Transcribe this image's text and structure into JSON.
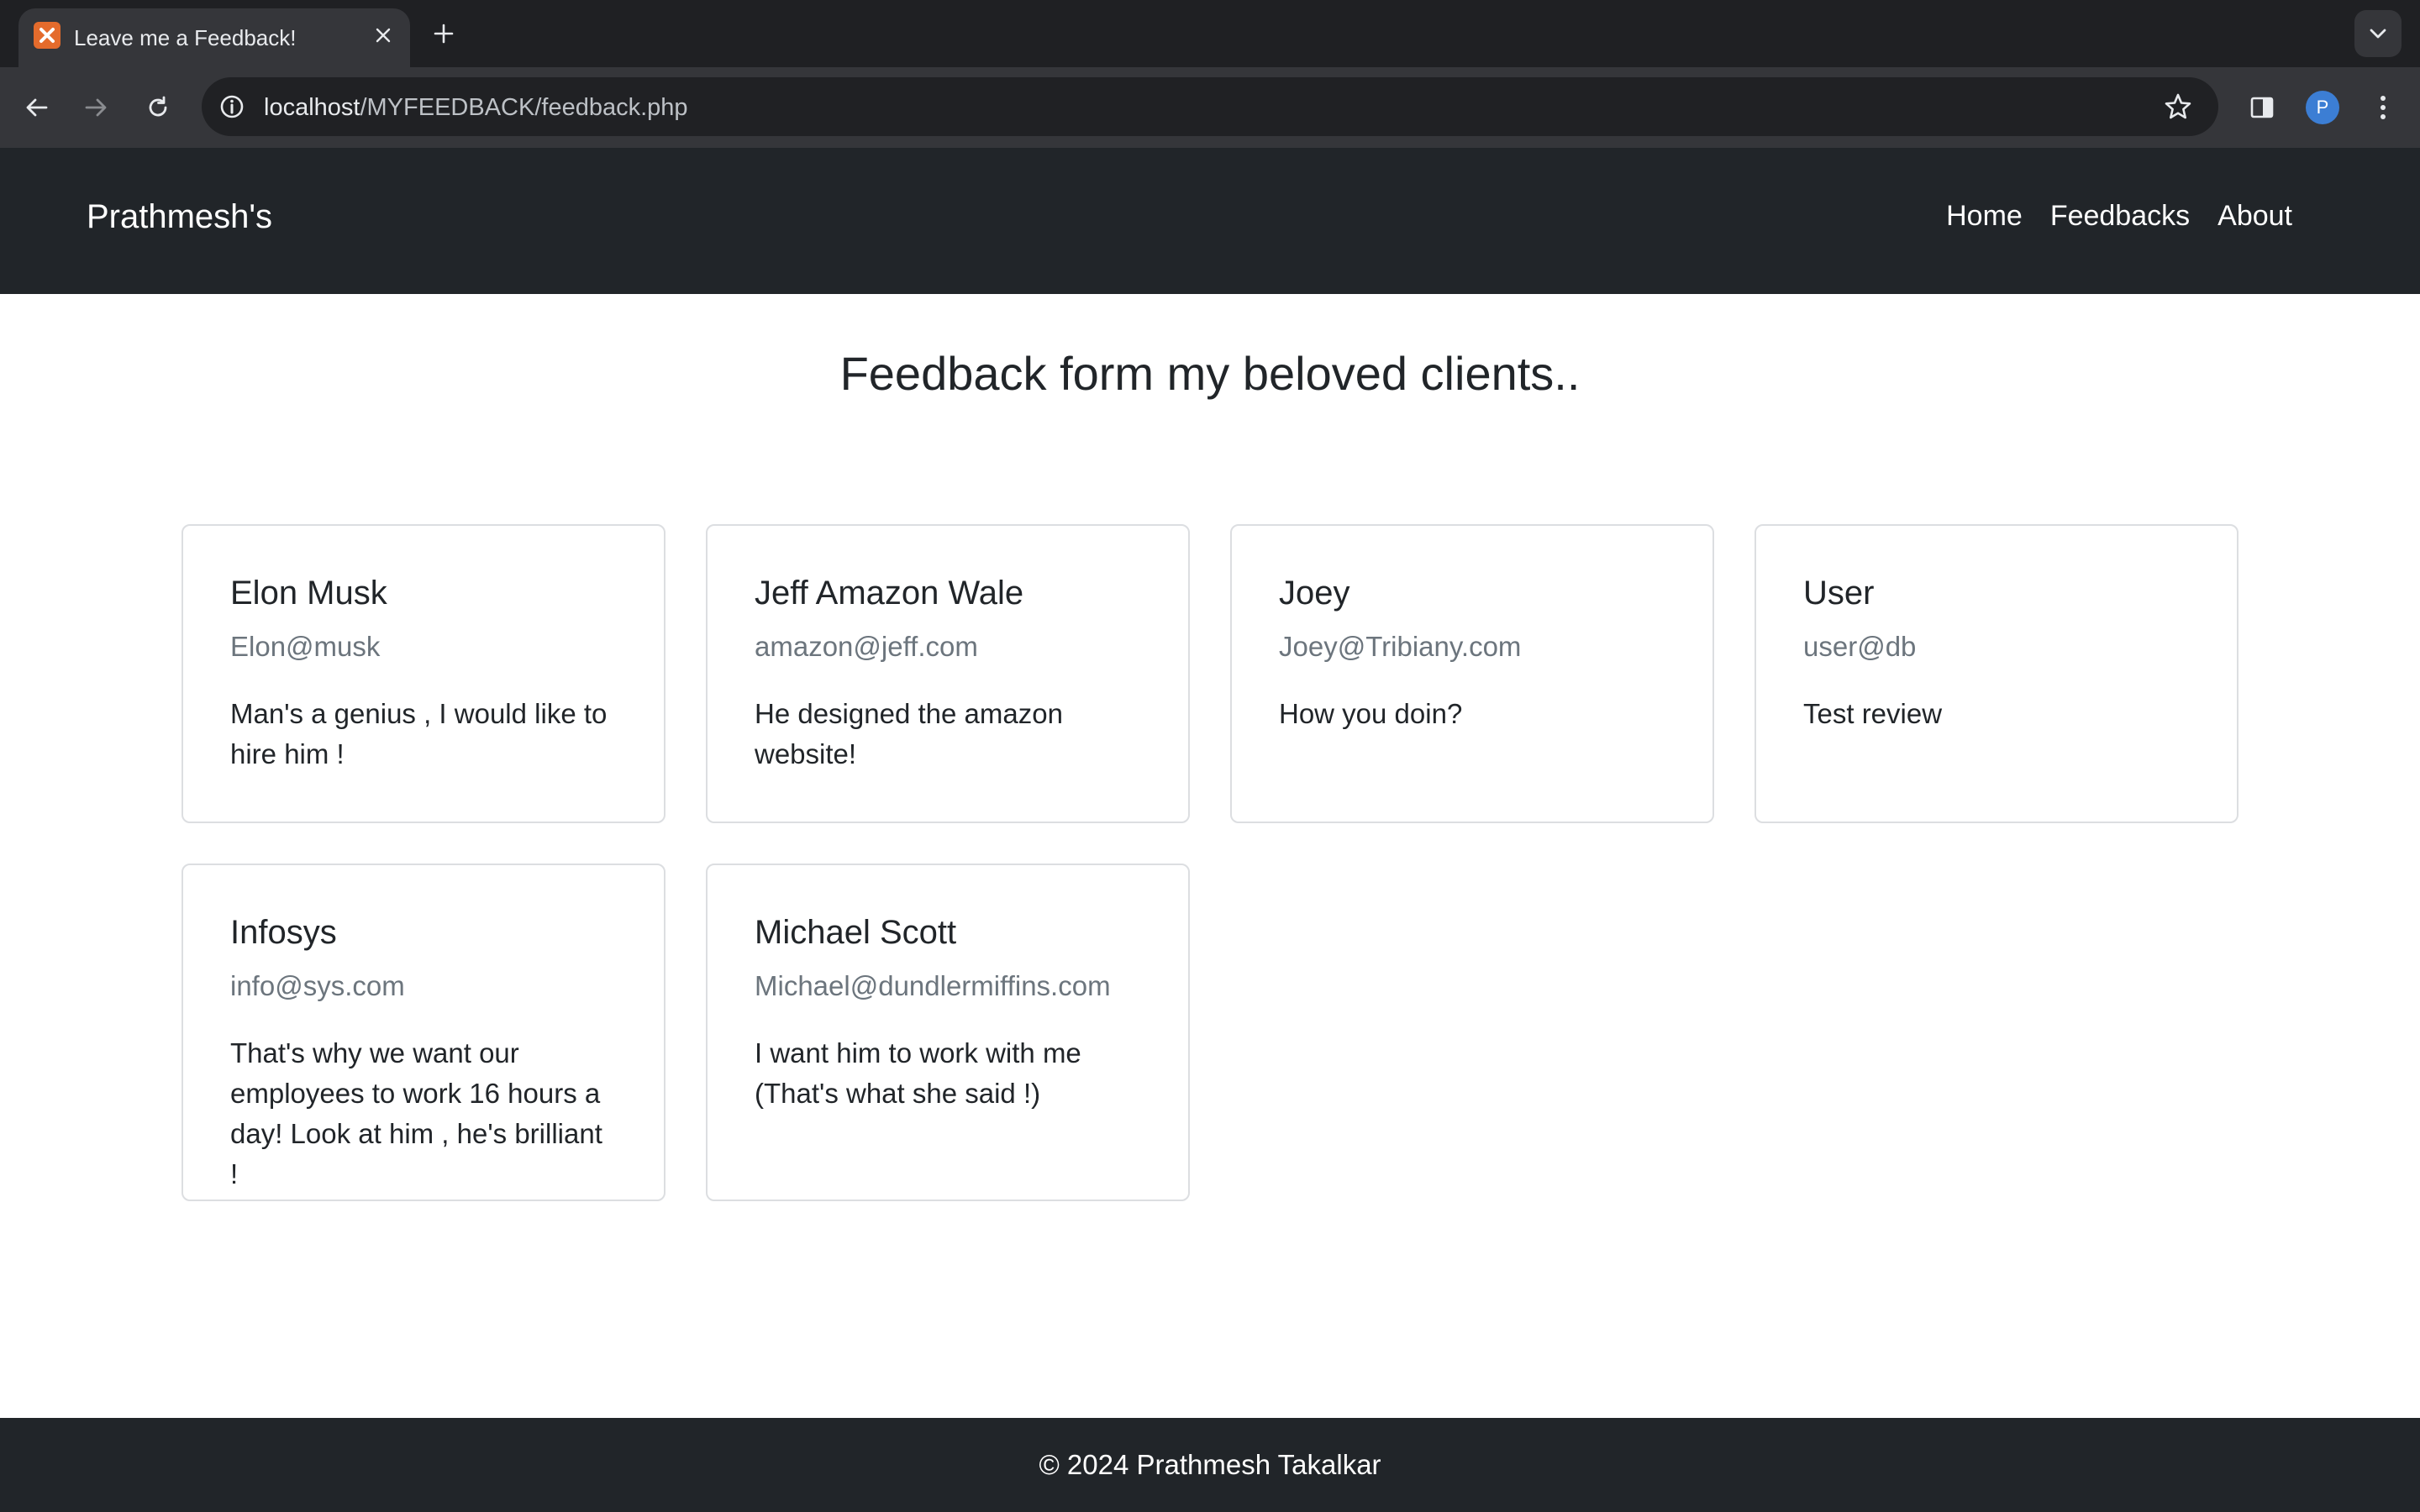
{
  "browser": {
    "tab_title": "Leave me a Feedback!",
    "url_host": "localhost",
    "url_path": "/MYFEEDBACK/feedback.php",
    "profile_initial": "P"
  },
  "navbar": {
    "brand": "Prathmesh's",
    "links": [
      "Home",
      "Feedbacks",
      "About"
    ]
  },
  "page": {
    "heading": "Feedback form my beloved clients.."
  },
  "feedbacks": [
    {
      "name": "Elon Musk",
      "email": "Elon@musk",
      "message": "Man's a genius , I would like to hire him !"
    },
    {
      "name": "Jeff Amazon Wale",
      "email": "amazon@jeff.com",
      "message": "He designed the amazon website!"
    },
    {
      "name": "Joey",
      "email": "Joey@Tribiany.com",
      "message": "How you doin?"
    },
    {
      "name": "User",
      "email": "user@db",
      "message": "Test review"
    },
    {
      "name": "Infosys",
      "email": "info@sys.com",
      "message": "That's why we want our employees to work 16 hours a day! Look at him , he's brilliant !"
    },
    {
      "name": "Michael Scott",
      "email": "Michael@dundlermiffins.com",
      "message": "I want him to work with me (That's what she said !)"
    }
  ],
  "footer": {
    "text": "© 2024 Prathmesh Takalkar"
  },
  "colors": {
    "navbar_bg": "#212529",
    "card_border": "#dcdee1",
    "muted_text": "#6c757d"
  }
}
